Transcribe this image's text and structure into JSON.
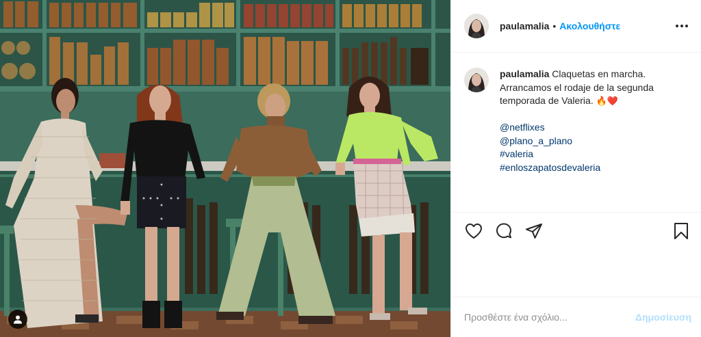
{
  "post": {
    "username": "paulamalia",
    "separator": "•",
    "follow_label": "Ακολουθήστε",
    "more_icon": "more-horizontal-icon"
  },
  "caption": {
    "username": "paulamalia",
    "text": "Claquetas en marcha. Arrancamos el rodaje de la segunda temporada de Valeria.",
    "emojis": "🔥❤️",
    "links": [
      "@netflixes",
      "@plano_a_plano",
      "#valeria",
      "#enloszapatosdevaleria"
    ]
  },
  "actions": {
    "like_icon": "heart-icon",
    "comment_icon": "comment-icon",
    "share_icon": "share-icon",
    "save_icon": "bookmark-icon"
  },
  "comment_box": {
    "placeholder": "Προσθέστε ένα σχόλιο...",
    "value": "",
    "post_label": "Δημοσίευση"
  },
  "colors": {
    "follow": "#0095f6",
    "link": "#00376b",
    "post_disabled": "#b2dffc",
    "photo_background": "#3d6f5e"
  }
}
